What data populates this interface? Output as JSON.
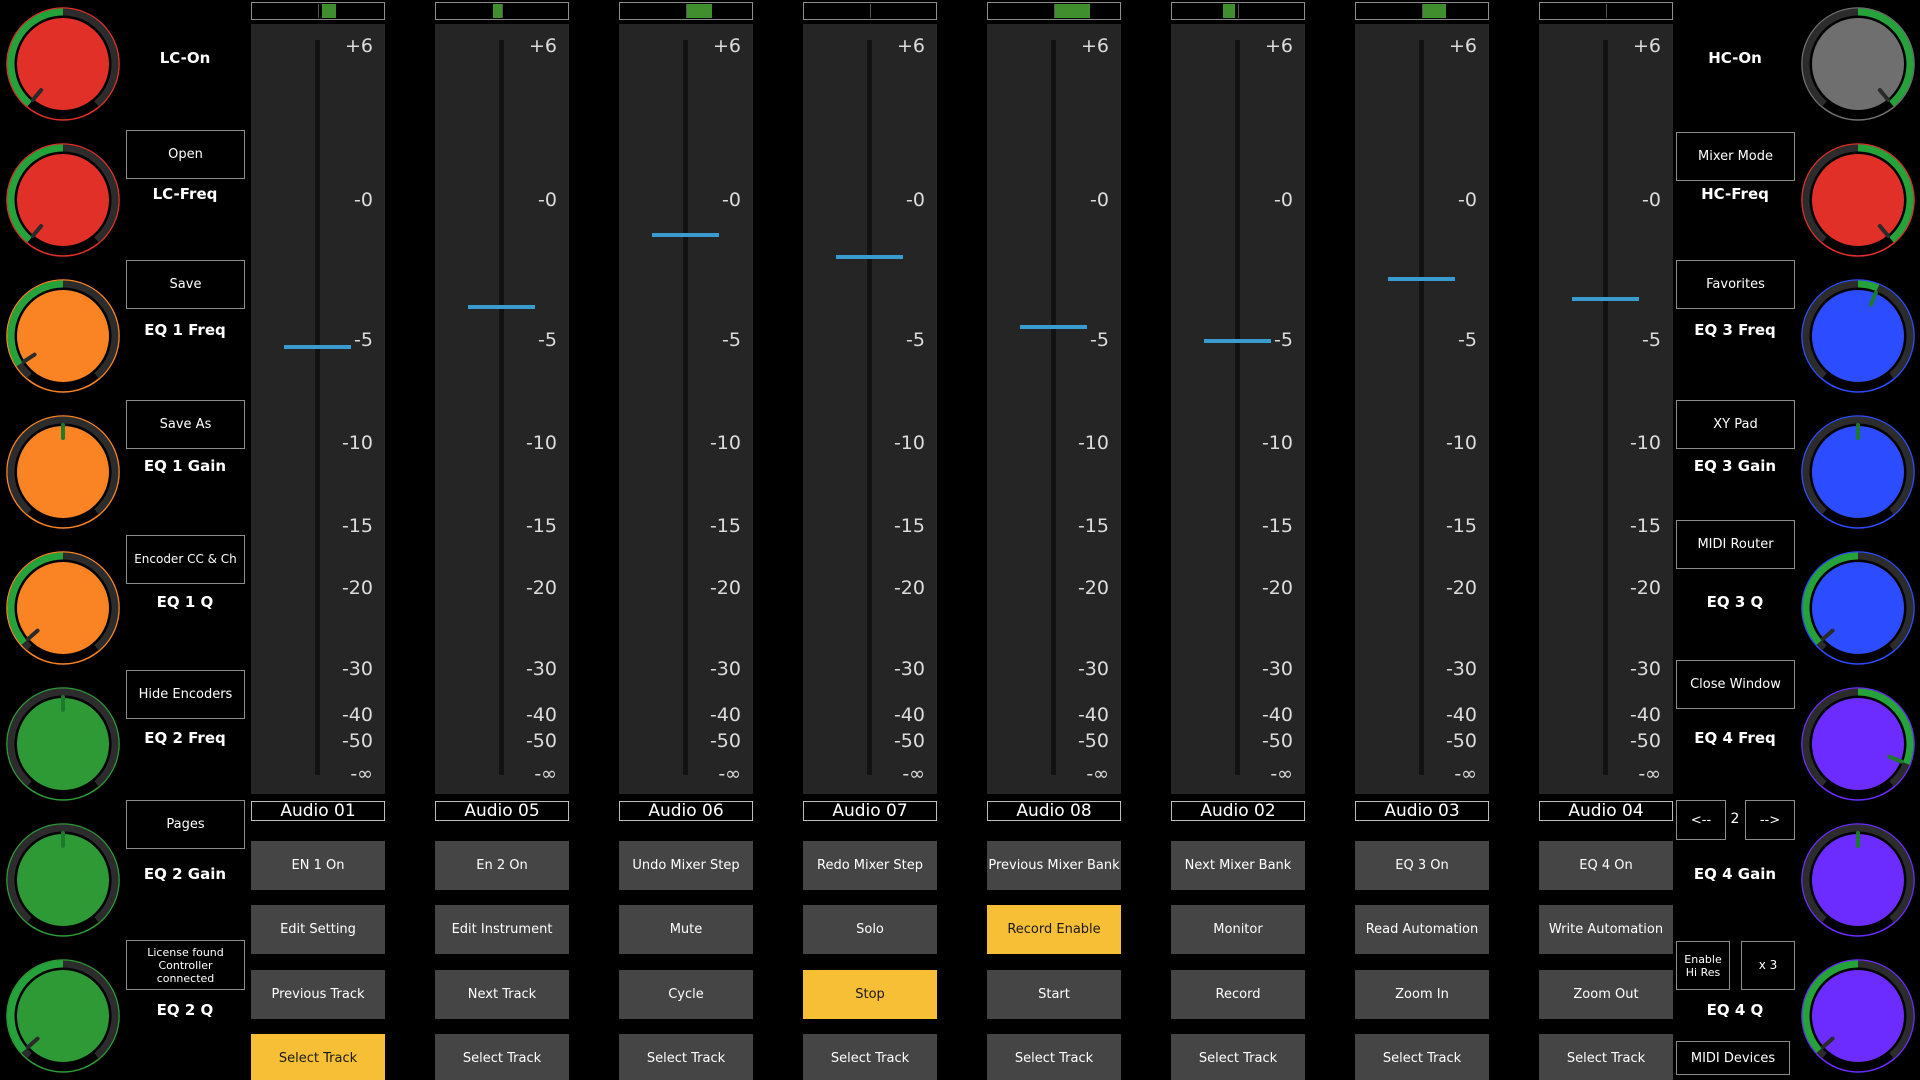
{
  "left_knobs": [
    {
      "label": "LC-On",
      "color": "#e03028",
      "value": 0.0
    },
    {
      "label": "LC-Freq",
      "color": "#e03028",
      "value": 0.0
    },
    {
      "label": "EQ 1 Freq",
      "color": "#fa8423",
      "value": 0.06
    },
    {
      "label": "EQ 1 Gain",
      "color": "#fa8423",
      "value": 0.5
    },
    {
      "label": "EQ 1 Q",
      "color": "#fa8423",
      "value": 0.03
    },
    {
      "label": "EQ 2 Freq",
      "color": "#2e9a36",
      "value": 0.5
    },
    {
      "label": "EQ 2 Gain",
      "color": "#2e9a36",
      "value": 0.5
    },
    {
      "label": "EQ 2 Q",
      "color": "#2e9a36",
      "value": 0.03
    }
  ],
  "left_buttons": [
    "Open",
    "Save",
    "Save As",
    "Encoder CC & Ch",
    "Hide Encoders",
    "Pages",
    "License found Controller connected"
  ],
  "right_knobs": [
    {
      "label": "HC-On",
      "color": "#6f6f6f",
      "value": 1.0
    },
    {
      "label": "HC-Freq",
      "color": "#e03028",
      "value": 1.0
    },
    {
      "label": "EQ 3 Freq",
      "color": "#2c4dff",
      "value": 0.58
    },
    {
      "label": "EQ 3 Gain",
      "color": "#2c4dff",
      "value": 0.5
    },
    {
      "label": "EQ 3 Q",
      "color": "#2c4dff",
      "value": 0.03
    },
    {
      "label": "EQ 4 Freq",
      "color": "#6c2cff",
      "value": 0.9
    },
    {
      "label": "EQ 4 Gain",
      "color": "#6c2cff",
      "value": 0.5
    },
    {
      "label": "EQ 4 Q",
      "color": "#6c2cff",
      "value": 0.03
    }
  ],
  "right_buttons": [
    "Mixer Mode",
    "Favorites",
    "XY Pad",
    "MIDI Router",
    "Close Window"
  ],
  "right_nav": {
    "prev": "<--",
    "page": "2",
    "next": "-->"
  },
  "right_misc": {
    "hires": "Enable Hi Res",
    "mult": "x 3",
    "midi": "MIDI Devices"
  },
  "fader_scale": [
    "+6",
    "-0",
    "-5",
    "-10",
    "-15",
    "-20",
    "-30",
    "-40",
    "-50",
    "-∞"
  ],
  "strips": [
    {
      "name": "Audio 01",
      "level": [
        0.53,
        0.64
      ],
      "fader_db": -5.3,
      "buttons": [
        {
          "label": "EN 1 On"
        },
        {
          "label": "Edit Setting"
        },
        {
          "label": "Previous Track"
        },
        {
          "label": "Select Track",
          "active": true
        }
      ]
    },
    {
      "name": "Audio 05",
      "level": [
        0.43,
        0.5
      ],
      "fader_db": -3.8,
      "buttons": [
        {
          "label": "En 2 On"
        },
        {
          "label": "Edit Instrument"
        },
        {
          "label": "Next Track"
        },
        {
          "label": "Select Track"
        }
      ]
    },
    {
      "name": "Audio 06",
      "level": [
        0.5,
        0.7
      ],
      "fader_db": -1.2,
      "buttons": [
        {
          "label": "Undo Mixer Step"
        },
        {
          "label": "Mute"
        },
        {
          "label": "Cycle"
        },
        {
          "label": "Select Track"
        }
      ]
    },
    {
      "name": "Audio 07",
      "level": [
        0.5,
        0.5
      ],
      "fader_db": -2.0,
      "buttons": [
        {
          "label": "Redo Mixer Step"
        },
        {
          "label": "Solo"
        },
        {
          "label": "Stop",
          "active": true
        },
        {
          "label": "Select Track"
        }
      ]
    },
    {
      "name": "Audio 08",
      "level": [
        0.5,
        0.77
      ],
      "fader_db": -4.5,
      "buttons": [
        {
          "label": "Previous Mixer Bank"
        },
        {
          "label": "Record Enable",
          "active": true
        },
        {
          "label": "Start"
        },
        {
          "label": "Select Track"
        }
      ]
    },
    {
      "name": "Audio 02",
      "level": [
        0.39,
        0.48
      ],
      "fader_db": -5.0,
      "buttons": [
        {
          "label": "Next Mixer Bank"
        },
        {
          "label": "Monitor"
        },
        {
          "label": "Record"
        },
        {
          "label": "Select Track"
        }
      ]
    },
    {
      "name": "Audio 03",
      "level": [
        0.5,
        0.68
      ],
      "fader_db": -2.8,
      "buttons": [
        {
          "label": "EQ 3 On"
        },
        {
          "label": "Read Automation"
        },
        {
          "label": "Zoom In"
        },
        {
          "label": "Select Track"
        }
      ]
    },
    {
      "name": "Audio 04",
      "level": [
        0.5,
        0.5
      ],
      "fader_db": -3.5,
      "buttons": [
        {
          "label": "EQ 4 On"
        },
        {
          "label": "Write Automation"
        },
        {
          "label": "Zoom Out"
        },
        {
          "label": "Select Track"
        }
      ]
    }
  ],
  "colors": {
    "accent_active": "#f6bf35",
    "fader_handle": "#3a9bd1",
    "meter_level": "#3f8f2e",
    "button_gray": "#454545"
  }
}
